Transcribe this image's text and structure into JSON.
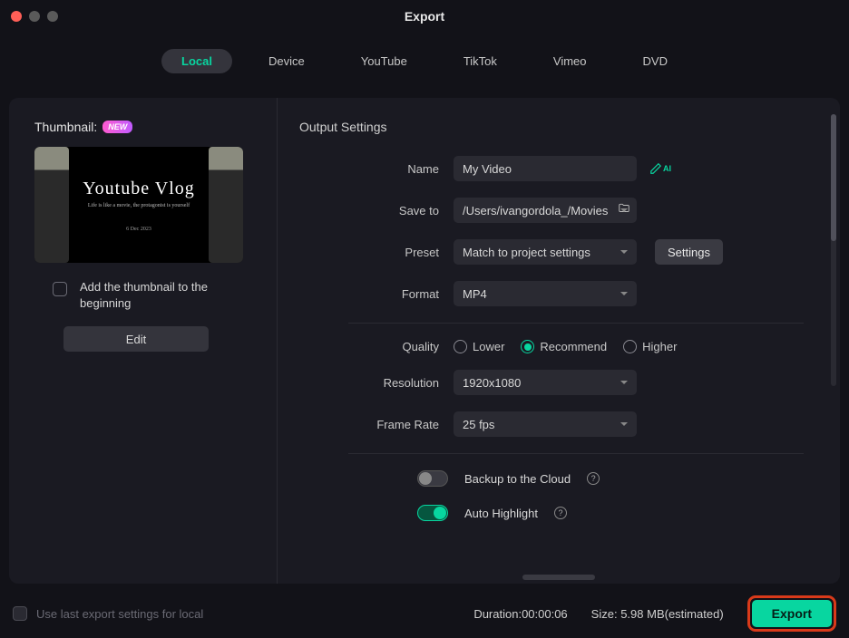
{
  "window": {
    "title": "Export"
  },
  "tabs": {
    "local": "Local",
    "device": "Device",
    "youtube": "YouTube",
    "tiktok": "TikTok",
    "vimeo": "Vimeo",
    "dvd": "DVD"
  },
  "thumbnail": {
    "label": "Thumbnail:",
    "new_badge": "NEW",
    "preview_main": "Youtube Vlog",
    "preview_sub": "Life is like a movie, the protagonist is yourself",
    "preview_date": "6 Dec 2023",
    "add_label": "Add the thumbnail to the beginning",
    "edit_label": "Edit"
  },
  "output": {
    "section_title": "Output Settings",
    "name_label": "Name",
    "name_value": "My Video",
    "saveto_label": "Save to",
    "saveto_value": "/Users/ivangordola_/Movies",
    "preset_label": "Preset",
    "preset_value": "Match to project settings",
    "settings_btn": "Settings",
    "format_label": "Format",
    "format_value": "MP4",
    "quality_label": "Quality",
    "quality_options": {
      "lower": "Lower",
      "recommend": "Recommend",
      "higher": "Higher"
    },
    "quality_selected": "recommend",
    "resolution_label": "Resolution",
    "resolution_value": "1920x1080",
    "framerate_label": "Frame Rate",
    "framerate_value": "25 fps",
    "backup_label": "Backup to the Cloud",
    "autohl_label": "Auto Highlight"
  },
  "footer": {
    "use_last_label": "Use last export settings for local",
    "duration_label": "Duration:",
    "duration_value": "00:00:06",
    "size_label": "Size:",
    "size_value": "5.98 MB",
    "size_suffix": "(estimated)",
    "export_btn": "Export"
  }
}
